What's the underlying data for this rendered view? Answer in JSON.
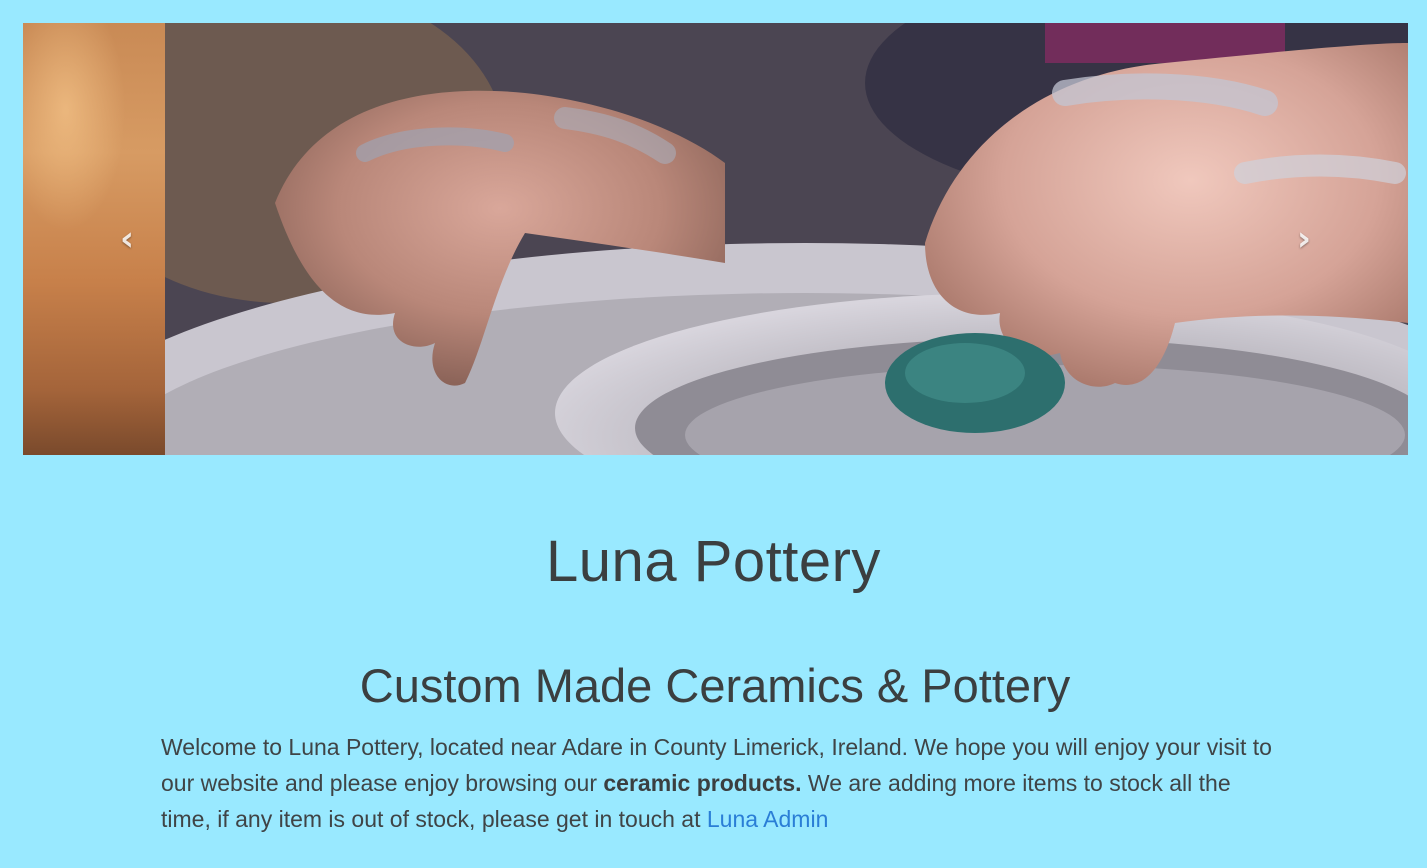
{
  "carousel": {
    "prev_icon": "chevron-left-icon",
    "next_icon": "chevron-right-icon",
    "prev_glyph": "‹",
    "next_glyph": "›"
  },
  "site": {
    "title": "Luna Pottery"
  },
  "section": {
    "heading": "Custom Made Ceramics & Pottery"
  },
  "intro": {
    "text_before": "Welcome to Luna Pottery, located near Adare in County Limerick, Ireland. We hope you will enjoy your visit to our website and please enjoy browsing our ",
    "products_link": "ceramic products.",
    "text_middle": " We are adding more items to stock all the time, if any item is out of stock, please get in touch at ",
    "admin_link": "Luna Admin"
  },
  "colors": {
    "background": "#99e9ff",
    "text": "#3b3f40",
    "link": "#2a7ed6"
  }
}
